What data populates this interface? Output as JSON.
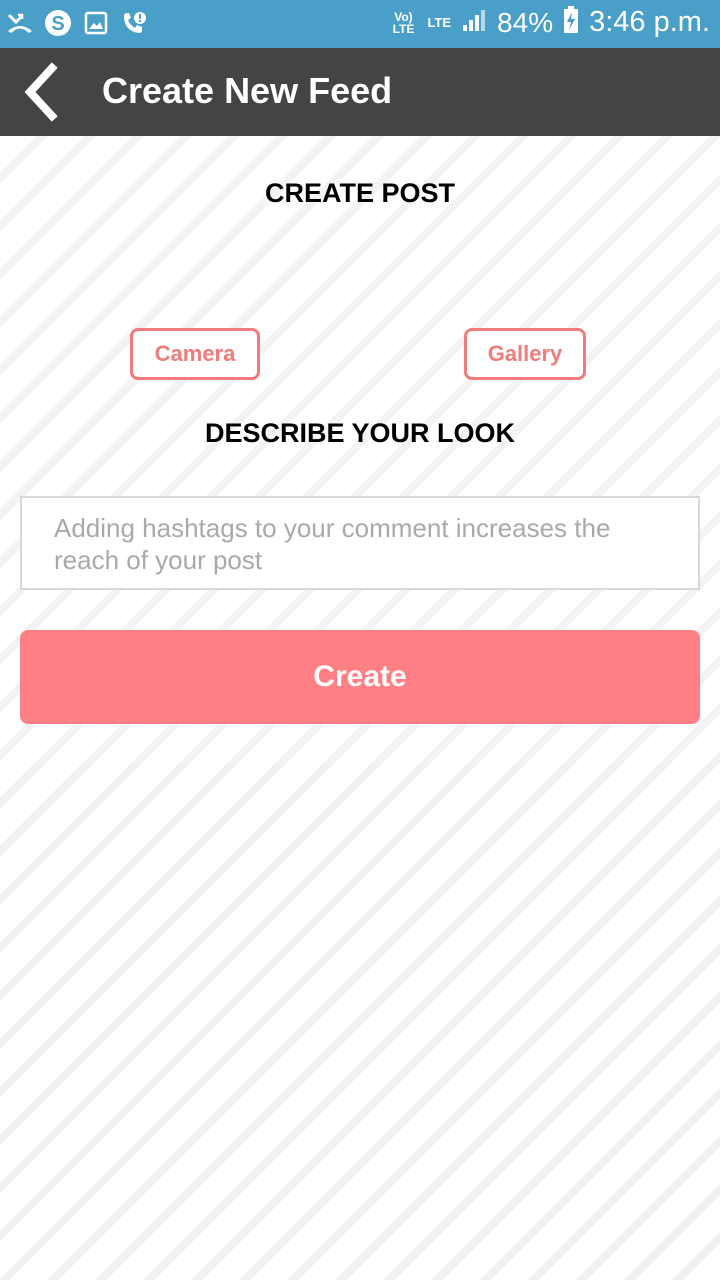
{
  "status_bar": {
    "volte": "Vo) LTE",
    "network": "LTE",
    "battery": "84%",
    "time": "3:46 p.m.",
    "left_icons": [
      "missed-call-icon",
      "skype-icon",
      "gallery-icon",
      "wifi-call-alert-icon"
    ]
  },
  "app_bar": {
    "title": "Create New Feed",
    "back_icon": "chevron-left-icon"
  },
  "form": {
    "create_post_heading": "CREATE POST",
    "camera_label": "Camera",
    "gallery_label": "Gallery",
    "describe_heading": "DESCRIBE YOUR LOOK",
    "comment_placeholder": "Adding hashtags to your comment increases the reach of your post",
    "create_label": "Create"
  },
  "colors": {
    "status_bar": "#4a9fc8",
    "app_bar": "#444444",
    "accent": "#ff8084",
    "outline": "#f07b7b"
  }
}
